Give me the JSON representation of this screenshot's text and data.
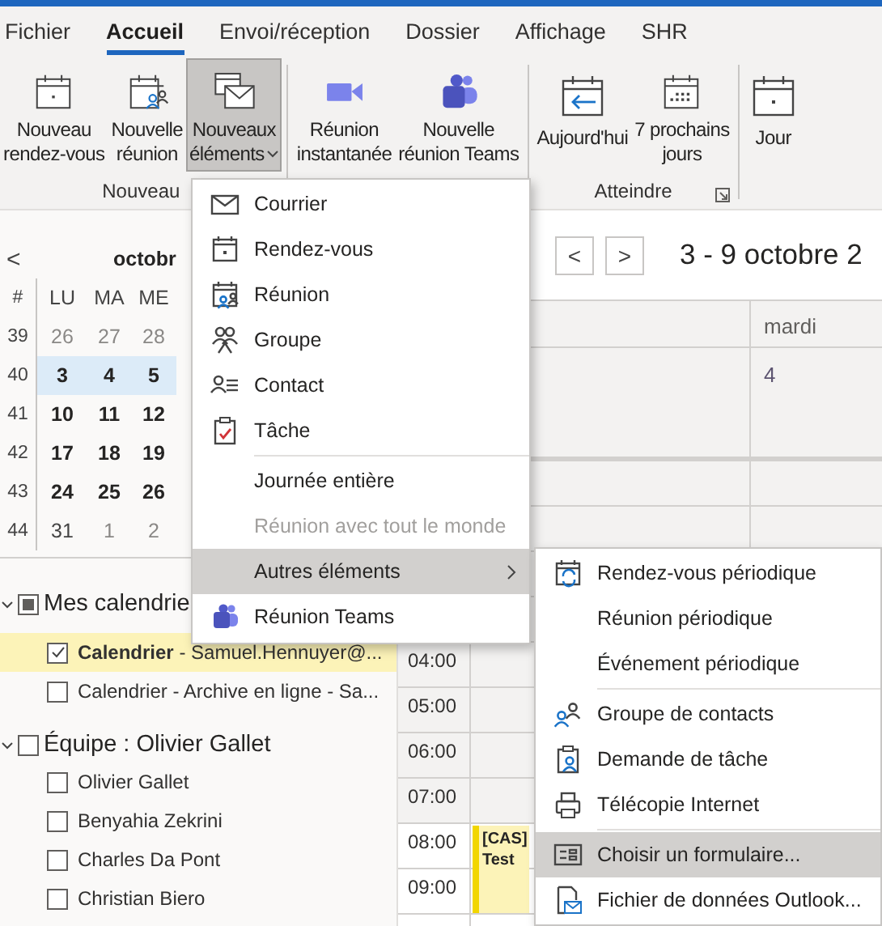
{
  "ribbon_tabs": [
    {
      "label": "Fichier",
      "selected": false
    },
    {
      "label": "Accueil",
      "selected": true
    },
    {
      "label": "Envoi/réception",
      "selected": false
    },
    {
      "label": "Dossier",
      "selected": false
    },
    {
      "label": "Affichage",
      "selected": false
    },
    {
      "label": "SHR",
      "selected": false
    }
  ],
  "ribbon_groups": [
    {
      "label": "Nouveau",
      "buttons": [
        {
          "lines": [
            "Nouveau",
            "rendez-vous"
          ],
          "pressed": false,
          "dropdown": false
        },
        {
          "lines": [
            "Nouvelle",
            "réunion"
          ],
          "pressed": false,
          "dropdown": false
        },
        {
          "lines": [
            "Nouveaux",
            "éléments"
          ],
          "pressed": true,
          "dropdown": true
        }
      ]
    },
    {
      "buttons": [
        {
          "lines": [
            "Réunion",
            "instantanée"
          ],
          "pressed": false,
          "dropdown": false
        },
        {
          "lines": [
            "Nouvelle",
            "réunion Teams"
          ],
          "pressed": false,
          "dropdown": false
        }
      ]
    },
    {
      "label": "Atteindre",
      "launcher": true,
      "buttons": [
        {
          "lines": [
            "Aujourd'hui"
          ],
          "pressed": false,
          "dropdown": false
        },
        {
          "lines": [
            "7 prochains",
            "jours"
          ],
          "pressed": false,
          "dropdown": false
        }
      ]
    },
    {
      "buttons": [
        {
          "lines": [
            "Jour"
          ],
          "pressed": false,
          "dropdown": false
        }
      ]
    }
  ],
  "mini_calendar": {
    "prev": "<",
    "month": "octobr",
    "headers": [
      "#",
      "LU",
      "MA",
      "ME"
    ],
    "weeks": [
      {
        "number": "39",
        "selected": false,
        "days": [
          {
            "day": "26",
            "kind": "muted"
          },
          {
            "day": "27",
            "kind": "muted"
          },
          {
            "day": "28",
            "kind": "muted"
          }
        ]
      },
      {
        "number": "40",
        "selected": true,
        "days": [
          {
            "day": "3",
            "kind": "bold"
          },
          {
            "day": "4",
            "kind": "bold"
          },
          {
            "day": "5",
            "kind": "bold"
          }
        ]
      },
      {
        "number": "41",
        "selected": false,
        "days": [
          {
            "day": "10",
            "kind": "bold"
          },
          {
            "day": "11",
            "kind": "bold"
          },
          {
            "day": "12",
            "kind": "bold"
          }
        ]
      },
      {
        "number": "42",
        "selected": false,
        "days": [
          {
            "day": "17",
            "kind": "bold"
          },
          {
            "day": "18",
            "kind": "bold"
          },
          {
            "day": "19",
            "kind": "bold"
          }
        ]
      },
      {
        "number": "43",
        "selected": false,
        "days": [
          {
            "day": "24",
            "kind": "bold"
          },
          {
            "day": "25",
            "kind": "bold"
          },
          {
            "day": "26",
            "kind": "bold"
          }
        ]
      },
      {
        "number": "44",
        "selected": false,
        "days": [
          {
            "day": "31",
            "kind": "normal"
          },
          {
            "day": "1",
            "kind": "muted"
          },
          {
            "day": "2",
            "kind": "muted"
          }
        ]
      }
    ]
  },
  "calendar_groups": [
    {
      "name": "Mes calendrie",
      "expanded": true,
      "partial": true,
      "items": [
        {
          "label": "**Calendrier** - Samuel.Hennuyer@...",
          "checked": true,
          "selected": true
        },
        {
          "label": "Calendrier - Archive en ligne - Sa...",
          "checked": false,
          "selected": false
        }
      ]
    },
    {
      "name": "Équipe : Olivier Gallet",
      "expanded": true,
      "partial": false,
      "items": [
        {
          "label": "Olivier Gallet",
          "checked": false,
          "selected": false
        },
        {
          "label": "Benyahia Zekrini",
          "checked": false,
          "selected": false
        },
        {
          "label": "Charles Da Pont",
          "checked": false,
          "selected": false
        },
        {
          "label": "Christian Biero",
          "checked": false,
          "selected": false
        }
      ]
    }
  ],
  "calendar_view": {
    "prev": "<",
    "next": ">",
    "title": "3 - 9 octobre 2",
    "day_name": "mardi",
    "day_number": "4",
    "hours": [
      {
        "time": "04:00",
        "working": false
      },
      {
        "time": "05:00",
        "working": false
      },
      {
        "time": "06:00",
        "working": false
      },
      {
        "time": "07:00",
        "working": false
      },
      {
        "time": "08:00",
        "working": true
      },
      {
        "time": "09:00",
        "working": true
      }
    ],
    "event": {
      "lines": [
        "[CAS]",
        "Test"
      ]
    }
  },
  "new_items_menu": {
    "items": [
      {
        "kind": "item",
        "label": "Courrier",
        "disabled": false,
        "selected": false,
        "submenu": false
      },
      {
        "kind": "item",
        "label": "Rendez-vous",
        "disabled": false,
        "selected": false,
        "submenu": false
      },
      {
        "kind": "item",
        "label": "Réunion",
        "disabled": false,
        "selected": false,
        "submenu": false
      },
      {
        "kind": "item",
        "label": "Groupe",
        "disabled": false,
        "selected": false,
        "submenu": false
      },
      {
        "kind": "item",
        "label": "Contact",
        "disabled": false,
        "selected": false,
        "submenu": false
      },
      {
        "kind": "item",
        "label": "Tâche",
        "disabled": false,
        "selected": false,
        "submenu": false
      },
      {
        "kind": "separator"
      },
      {
        "kind": "item",
        "label": "Journée entière",
        "disabled": false,
        "selected": false,
        "submenu": false
      },
      {
        "kind": "item",
        "label": "Réunion avec tout le monde",
        "disabled": true,
        "selected": false,
        "submenu": false
      },
      {
        "kind": "item",
        "label": "Autres éléments",
        "disabled": false,
        "selected": true,
        "submenu": true
      },
      {
        "kind": "item",
        "label": "Réunion Teams",
        "disabled": false,
        "selected": false,
        "submenu": false
      }
    ]
  },
  "other_items_submenu": {
    "items": [
      {
        "kind": "item",
        "label": "Rendez-vous périodique",
        "disabled": false,
        "selected": false,
        "submenu": false
      },
      {
        "kind": "item",
        "label": "Réunion périodique",
        "disabled": false,
        "selected": false,
        "submenu": false
      },
      {
        "kind": "item",
        "label": "Événement périodique",
        "disabled": false,
        "selected": false,
        "submenu": false
      },
      {
        "kind": "separator"
      },
      {
        "kind": "item",
        "label": "Groupe de contacts",
        "disabled": false,
        "selected": false,
        "submenu": false
      },
      {
        "kind": "item",
        "label": "Demande de tâche",
        "disabled": false,
        "selected": false,
        "submenu": false
      },
      {
        "kind": "item",
        "label": "Télécopie Internet",
        "disabled": false,
        "selected": false,
        "submenu": false
      },
      {
        "kind": "separator"
      },
      {
        "kind": "item",
        "label": "Choisir un formulaire...",
        "disabled": false,
        "selected": true,
        "submenu": false
      },
      {
        "kind": "item",
        "label": "Fichier de données Outlook...",
        "disabled": false,
        "selected": false,
        "submenu": false
      }
    ]
  }
}
